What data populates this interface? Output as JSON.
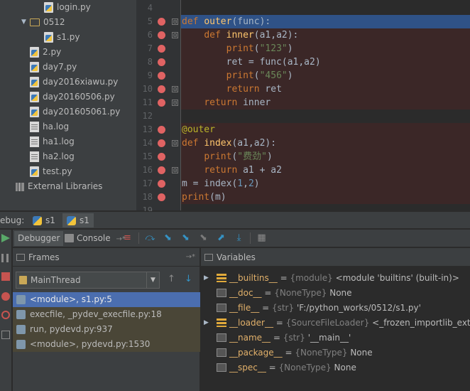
{
  "project_tree": [
    {
      "name": "login.py",
      "type": "py",
      "indent": 2,
      "expand": ""
    },
    {
      "name": "0512",
      "type": "folder",
      "indent": 1,
      "expand": "▼"
    },
    {
      "name": "s1.py",
      "type": "py",
      "indent": 2,
      "expand": ""
    },
    {
      "name": "2.py",
      "type": "py",
      "indent": 1,
      "expand": ""
    },
    {
      "name": "day7.py",
      "type": "py",
      "indent": 1,
      "expand": ""
    },
    {
      "name": "day2016xiawu.py",
      "type": "py",
      "indent": 1,
      "expand": ""
    },
    {
      "name": "day20160506.py",
      "type": "py",
      "indent": 1,
      "expand": ""
    },
    {
      "name": "day201605061.py",
      "type": "py",
      "indent": 1,
      "expand": ""
    },
    {
      "name": "ha.log",
      "type": "log",
      "indent": 1,
      "expand": ""
    },
    {
      "name": "ha1.log",
      "type": "log",
      "indent": 1,
      "expand": ""
    },
    {
      "name": "ha2.log",
      "type": "log",
      "indent": 1,
      "expand": ""
    },
    {
      "name": "test.py",
      "type": "py",
      "indent": 1,
      "expand": ""
    },
    {
      "name": "External Libraries",
      "type": "lib",
      "indent": 0,
      "expand": ""
    }
  ],
  "editor": {
    "lines": [
      {
        "num": "4",
        "bp": false,
        "fold": "",
        "state": "",
        "html": ""
      },
      {
        "num": "5",
        "bp": true,
        "fold": "⊟",
        "state": "cur",
        "html": "<span class=\"k\">def</span> <span class=\"f\">outer</span>(func):"
      },
      {
        "num": "6",
        "bp": true,
        "fold": "⊟",
        "state": "bp",
        "html": "    <span class=\"k\">def</span> <span class=\"f\">inner</span>(a1,a2):"
      },
      {
        "num": "7",
        "bp": true,
        "fold": "",
        "state": "bp",
        "html": "        <span class=\"k\">print</span>(<span class=\"s\">\"123\"</span>)"
      },
      {
        "num": "8",
        "bp": true,
        "fold": "",
        "state": "bp",
        "html": "        ret = func(a1,a2)"
      },
      {
        "num": "9",
        "bp": true,
        "fold": "",
        "state": "bp",
        "html": "        <span class=\"k\">print</span>(<span class=\"s\">\"456\"</span>)"
      },
      {
        "num": "10",
        "bp": true,
        "fold": "⊟",
        "state": "bp",
        "html": "        <span class=\"k\">return</span> ret"
      },
      {
        "num": "11",
        "bp": true,
        "fold": "⊟",
        "state": "bp",
        "html": "    <span class=\"k\">return</span> inner"
      },
      {
        "num": "12",
        "bp": false,
        "fold": "",
        "state": "",
        "html": ""
      },
      {
        "num": "13",
        "bp": true,
        "fold": "",
        "state": "bp",
        "html": "<span class=\"d\">@outer</span>"
      },
      {
        "num": "14",
        "bp": true,
        "fold": "⊟",
        "state": "bp",
        "html": "<span class=\"k\">def</span> <span class=\"f\">index</span>(a1,a2):"
      },
      {
        "num": "15",
        "bp": true,
        "fold": "",
        "state": "bp",
        "html": "    <span class=\"k\">print</span>(<span class=\"s\">\"费劲\"</span>)"
      },
      {
        "num": "16",
        "bp": true,
        "fold": "⊟",
        "state": "bp",
        "html": "    <span class=\"k\">return</span> a1 + a2"
      },
      {
        "num": "17",
        "bp": true,
        "fold": "",
        "state": "bp",
        "html": "m = index(<span class=\"n\">1</span>,<span class=\"n\">2</span>)"
      },
      {
        "num": "18",
        "bp": true,
        "fold": "",
        "state": "bp",
        "html": "<span class=\"k\">print</span>(m)"
      },
      {
        "num": "19",
        "bp": false,
        "fold": "",
        "state": "",
        "html": ""
      }
    ]
  },
  "debug_bar": {
    "label": "ebug:",
    "tabs": [
      "s1",
      "s1"
    ]
  },
  "debugger_toolbar": {
    "debugger_tab": "Debugger",
    "console_tab": "Console",
    "console_suffix": "→*"
  },
  "frames": {
    "title": "Frames",
    "pin": "→*",
    "thread": "MainThread",
    "items": [
      {
        "label": "<module>, s1.py:5",
        "state": "sel"
      },
      {
        "label": "execfile, _pydev_execfile.py:18",
        "state": "lib"
      },
      {
        "label": "run, pydevd.py:937",
        "state": "lib"
      },
      {
        "label": "<module>, pydevd.py:1530",
        "state": "lib"
      }
    ]
  },
  "variables": {
    "title": "Variables",
    "items": [
      {
        "expand": "▶",
        "icon": "grp",
        "name": "__builtins__",
        "type": "{module}",
        "value": "<module 'builtins' (built-in)>"
      },
      {
        "expand": "",
        "icon": "ref",
        "name": "__doc__",
        "type": "{NoneType}",
        "value": "None"
      },
      {
        "expand": "",
        "icon": "ref",
        "name": "__file__",
        "type": "{str}",
        "value": "'F:/python_works/0512/s1.py'"
      },
      {
        "expand": "▶",
        "icon": "grp",
        "name": "__loader__",
        "type": "{SourceFileLoader}",
        "value": "<_frozen_importlib_external.SourceFileLoader"
      },
      {
        "expand": "",
        "icon": "ref",
        "name": "__name__",
        "type": "{str}",
        "value": "'__main__'"
      },
      {
        "expand": "",
        "icon": "ref",
        "name": "__package__",
        "type": "{NoneType}",
        "value": "None"
      },
      {
        "expand": "",
        "icon": "ref",
        "name": "__spec__",
        "type": "{NoneType}",
        "value": "None"
      }
    ]
  },
  "colors": {
    "current_line": "#2f5287",
    "breakpoint_line": "#3b2727",
    "breakpoint": "#e06363",
    "selection": "#4b6eaf"
  }
}
